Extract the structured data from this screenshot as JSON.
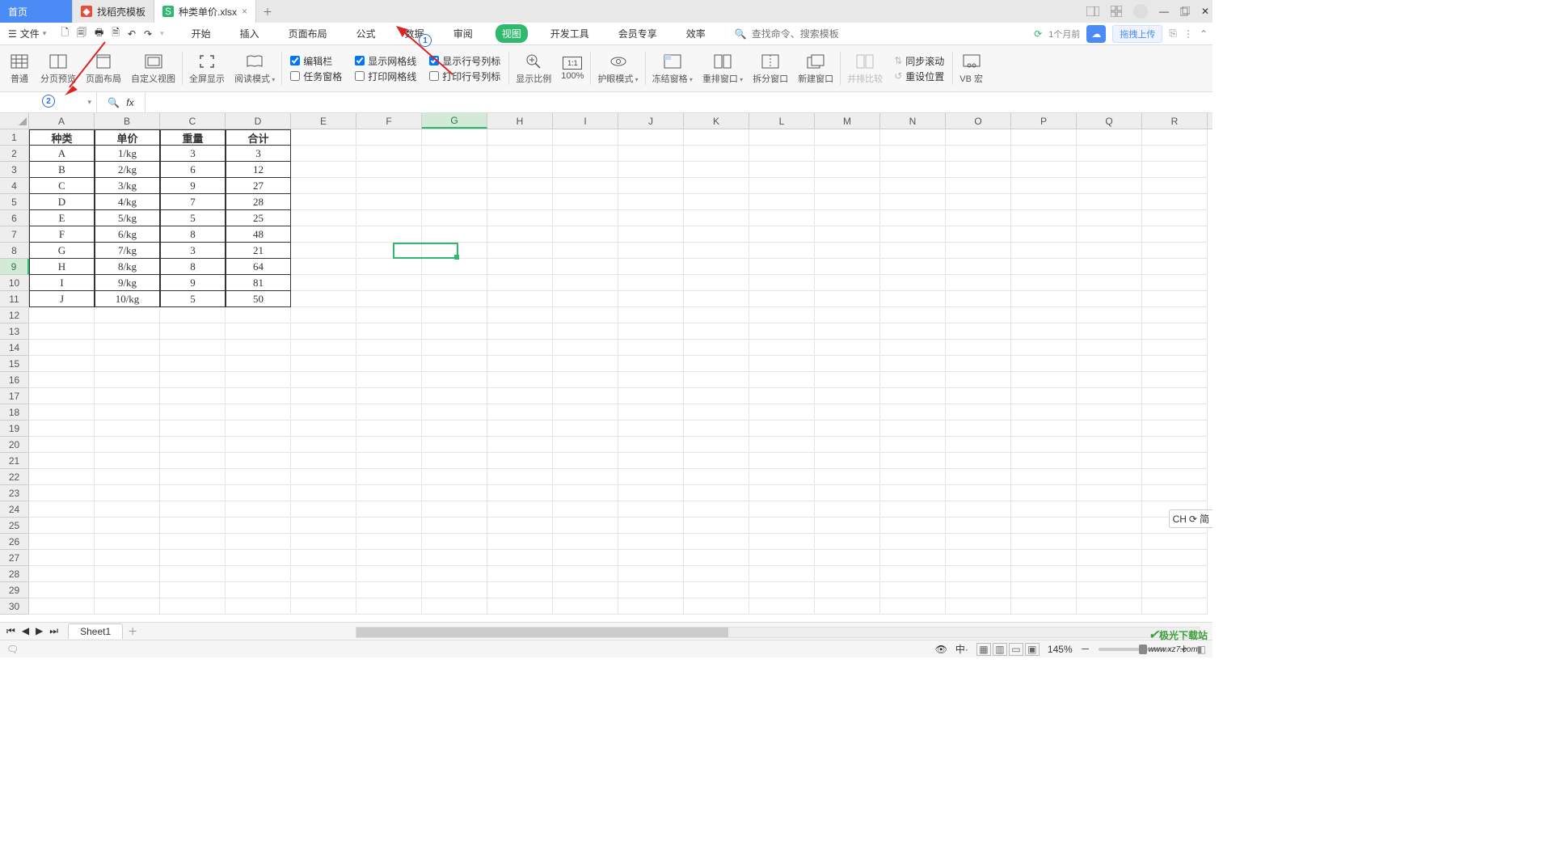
{
  "tabs": {
    "home": "首页",
    "template": "找稻壳模板",
    "file": "种类单价.xlsx"
  },
  "menu": {
    "file": "文件",
    "items": [
      "开始",
      "插入",
      "页面布局",
      "公式",
      "数据",
      "审阅",
      "视图",
      "开发工具",
      "会员专享",
      "效率"
    ],
    "active": "视图",
    "searchPlaceholder": "查找命令、搜索模板",
    "sync": "1个月前",
    "upload": "拖拽上传"
  },
  "ribbon": {
    "normal": "普通",
    "pagepreview": "分页预览",
    "pagelayout": "页面布局",
    "custom": "自定义视图",
    "fullscreen": "全屏显示",
    "readmode": "阅读模式",
    "editbar": "编辑栏",
    "taskpane": "任务窗格",
    "gridline": "显示网格线",
    "printgrid": "打印网格线",
    "rowcol": "显示行号列标",
    "printrowcol": "打印行号列标",
    "zoom": "显示比例",
    "z100": "100%",
    "eyecare": "护眼模式",
    "freeze": "冻结窗格",
    "arrange": "重排窗口",
    "split": "拆分窗口",
    "newwin": "新建窗口",
    "sidebyside": "并排比较",
    "syncscroll": "同步滚动",
    "resetpos": "重设位置",
    "vb": "VB 宏"
  },
  "formula": {
    "name": "",
    "fx": "fx"
  },
  "cols": [
    "A",
    "B",
    "C",
    "D",
    "E",
    "F",
    "G",
    "H",
    "I",
    "J",
    "K",
    "L",
    "M",
    "N",
    "O",
    "P",
    "Q",
    "R"
  ],
  "rowcount": 30,
  "selectedCell": {
    "col": 6,
    "row": 8
  },
  "table": {
    "headers": [
      "种类",
      "单价",
      "重量",
      "合计"
    ],
    "rows": [
      [
        "A",
        "1/kg",
        "3",
        "3"
      ],
      [
        "B",
        "2/kg",
        "6",
        "12"
      ],
      [
        "C",
        "3/kg",
        "9",
        "27"
      ],
      [
        "D",
        "4/kg",
        "7",
        "28"
      ],
      [
        "E",
        "5/kg",
        "5",
        "25"
      ],
      [
        "F",
        "6/kg",
        "8",
        "48"
      ],
      [
        "G",
        "7/kg",
        "3",
        "21"
      ],
      [
        "H",
        "8/kg",
        "8",
        "64"
      ],
      [
        "I",
        "9/kg",
        "9",
        "81"
      ],
      [
        "J",
        "10/kg",
        "5",
        "50"
      ]
    ]
  },
  "sheet": {
    "name": "Sheet1"
  },
  "status": {
    "zoom": "145%",
    "lang": "中·",
    "ime": "CH",
    "ime2": "简"
  },
  "ann": {
    "n1": "1",
    "n2": "2"
  },
  "watermark": {
    "t1": "极光下载站",
    "t2": "www.xz7.com"
  }
}
